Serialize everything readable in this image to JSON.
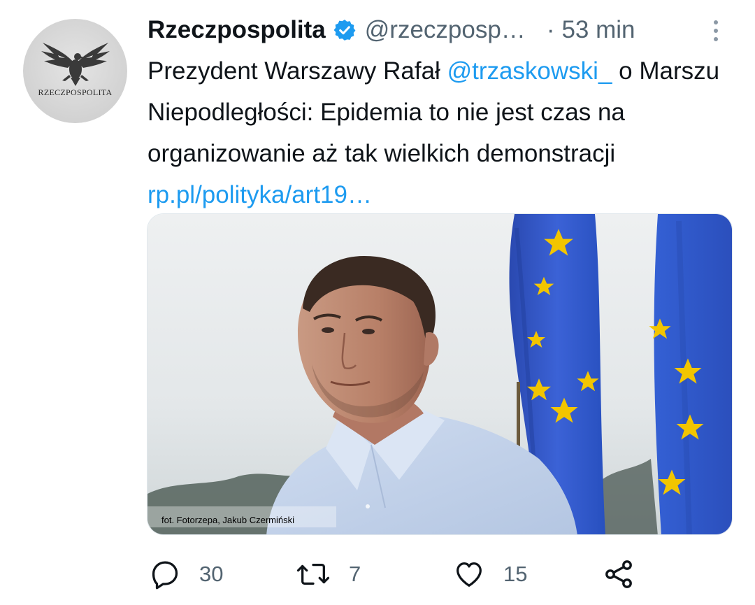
{
  "account": {
    "name": "Rzeczpospolita",
    "handle": "@rzeczposp…",
    "separator": "·",
    "time": "53 min",
    "avatar_text": "RZECZPOSPOLITA"
  },
  "tweet": {
    "text_part1": "Prezydent Warszawy Rafał ",
    "mention": "@trzaskowski_",
    "text_part2": " o Marszu Niepodległości: Epidemia to nie jest czas na organizowanie aż tak wielkich demonstracji ",
    "link": "rp.pl/polityka/art19…",
    "image_caption": "fot. Fotorzepa, Jakub Czermiński"
  },
  "actions": {
    "replies": "30",
    "retweets": "7",
    "likes": "15"
  },
  "icons": {
    "verified": "verified-badge-icon",
    "more": "more-vertical-icon",
    "reply": "reply-icon",
    "retweet": "retweet-icon",
    "like": "heart-icon",
    "share": "share-icon"
  },
  "colors": {
    "link": "#1d9bf0",
    "secondary_text": "#536471",
    "primary_text": "#0f1419",
    "eu_blue": "#2f55c6",
    "eu_star": "#f2c500"
  }
}
